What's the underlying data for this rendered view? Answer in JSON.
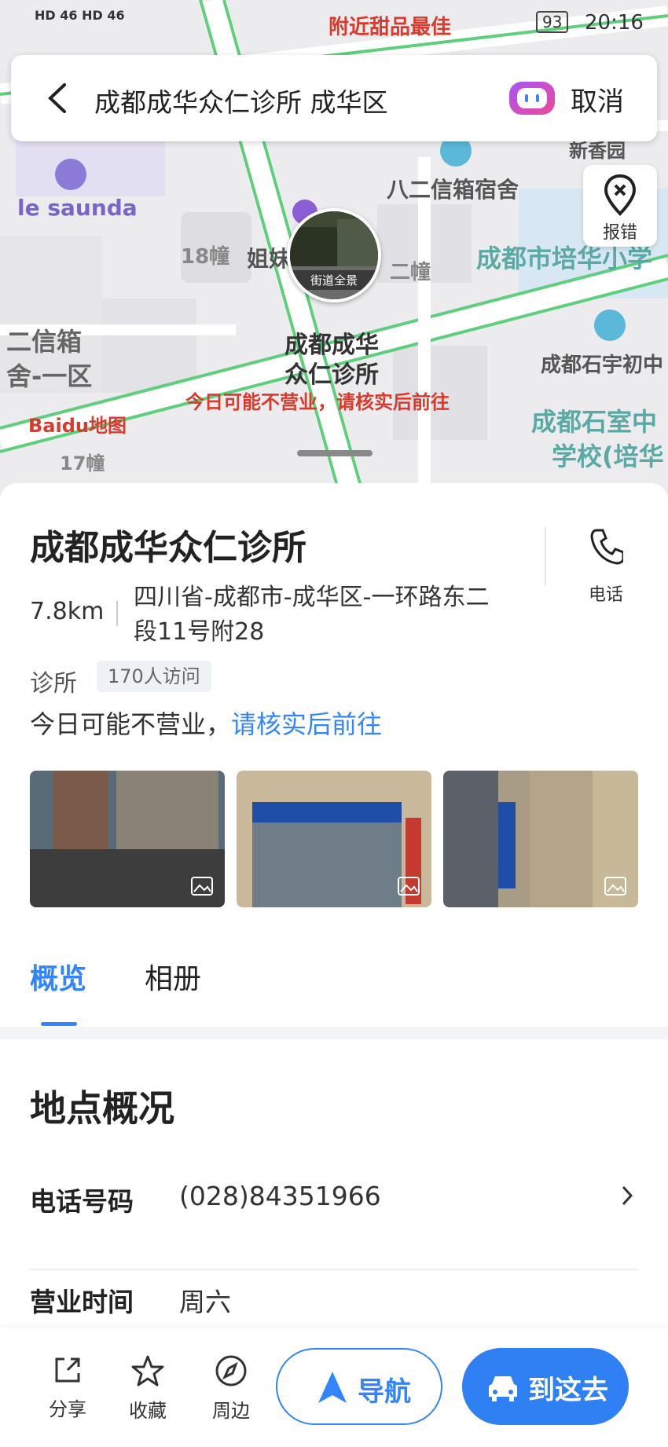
{
  "status_bar": {
    "signal_text": "HD 46 HD 46",
    "promo": "附近甜品最佳",
    "battery": "93",
    "time": "20:16"
  },
  "search": {
    "query": "成都成华众仁诊所 成华区",
    "cancel_label": "取消"
  },
  "map": {
    "labels": {
      "le_saunda": "le saunda",
      "bajer": "八二信箱宿舍",
      "xinxiangyuan": "新香园",
      "peihua": "成都市培华小学",
      "bld18": "18幢",
      "jie": "姐妹",
      "erchuang": "二幢",
      "left_box1": "二信箱",
      "left_box2": "舍-一区",
      "shiyu": "成都石宇初中",
      "shishi1": "成都石室中",
      "shishi2": "学校(培华",
      "bld17": "17幢",
      "poi_name1": "成都成华",
      "poi_name2": "众仁诊所",
      "poi_notice": "今日可能不营业，请核实后前往",
      "streetview": "街道全景",
      "baidu_logo": "Baidu地图"
    },
    "report_label": "报错"
  },
  "place": {
    "name": "成都成华众仁诊所",
    "phone_button_label": "电话",
    "distance": "7.8km",
    "address": "四川省-成都市-成华区-一环路东二段11号附28",
    "category": "诊所",
    "visits": "170人访问",
    "notice_prefix": "今日可能不营业，",
    "notice_link": "请核实后前往"
  },
  "tabs": [
    {
      "label": "概览",
      "active": true
    },
    {
      "label": "相册",
      "active": false
    }
  ],
  "overview": {
    "section_title": "地点概况",
    "phone_label": "电话号码",
    "phone_value": "(028)84351966",
    "hours_label": "营业时间",
    "hours_value": "周六"
  },
  "bottom_bar": {
    "share_label": "分享",
    "favorite_label": "收藏",
    "nearby_label": "周边",
    "navigate_label": "导航",
    "go_label": "到这去"
  },
  "colors": {
    "accent": "#3385ff",
    "go_button": "#2f80f2",
    "map_road": "#5fcf7d",
    "warning": "#d93a2b"
  }
}
